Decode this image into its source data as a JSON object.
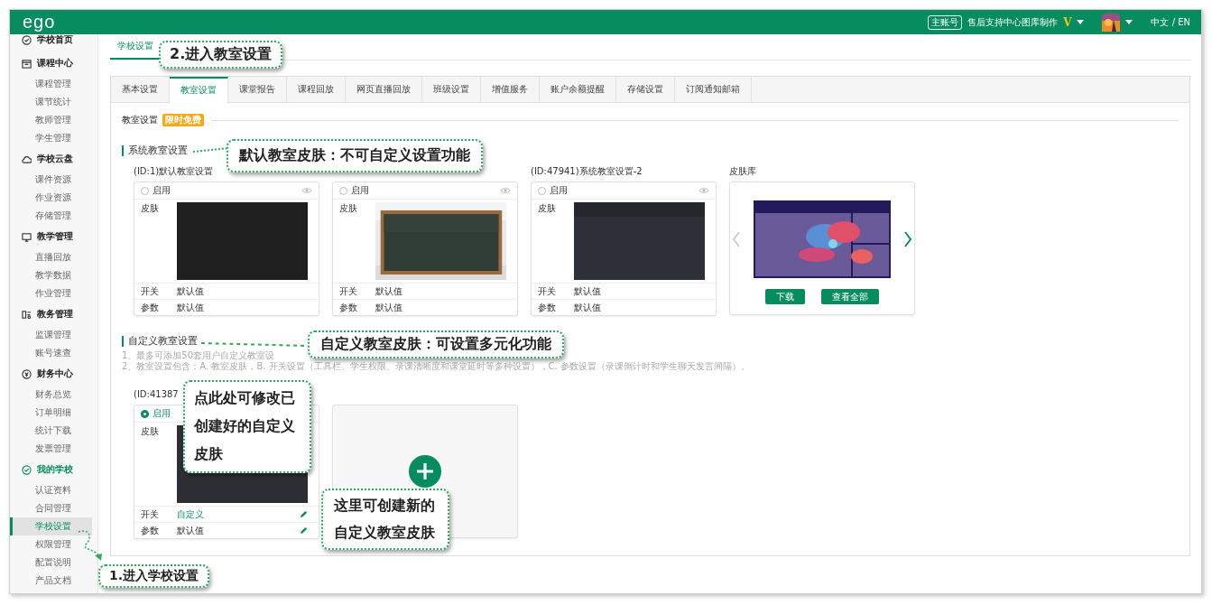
{
  "header": {
    "logo": "ego",
    "account_badge": "主账号",
    "account_name": "售后支持中心图库制作",
    "vip_mark": "V",
    "language": "中文 / EN"
  },
  "sidebar": [
    {
      "label": "学校首页",
      "selected": false
    },
    {
      "label": "课程中心",
      "selected": false,
      "children": [
        {
          "label": "课程管理",
          "selected": false
        },
        {
          "label": "课节统计",
          "selected": false
        },
        {
          "label": "教师管理",
          "selected": false
        },
        {
          "label": "学生管理",
          "selected": false
        }
      ]
    },
    {
      "label": "学校云盘",
      "selected": false,
      "children": [
        {
          "label": "课件资源",
          "selected": false
        },
        {
          "label": "作业资源",
          "selected": false
        },
        {
          "label": "存储管理",
          "selected": false
        }
      ]
    },
    {
      "label": "教学管理",
      "selected": false,
      "children": [
        {
          "label": "直播回放",
          "selected": false
        },
        {
          "label": "教学数据",
          "selected": false
        },
        {
          "label": "作业管理",
          "selected": false
        }
      ]
    },
    {
      "label": "教务管理",
      "selected": false,
      "children": [
        {
          "label": "监课管理",
          "selected": false
        },
        {
          "label": "账号速查",
          "selected": false
        }
      ]
    },
    {
      "label": "财务中心",
      "selected": false,
      "children": [
        {
          "label": "财务总览",
          "selected": false
        },
        {
          "label": "订单明细",
          "selected": false
        },
        {
          "label": "统计下载",
          "selected": false
        },
        {
          "label": "发票管理",
          "selected": false
        }
      ]
    },
    {
      "label": "我的学校",
      "selected": true,
      "children": [
        {
          "label": "认证资料",
          "selected": false
        },
        {
          "label": "合同管理",
          "selected": false
        },
        {
          "label": "学校设置",
          "selected": true
        },
        {
          "label": "权限管理",
          "selected": false
        },
        {
          "label": "配置说明",
          "selected": false
        },
        {
          "label": "产品文档",
          "selected": false
        }
      ]
    }
  ],
  "page_tabs": [
    {
      "label": "学校设置",
      "selected": true
    }
  ],
  "tabs": [
    {
      "label": "基本设置",
      "selected": false
    },
    {
      "label": "教室设置",
      "selected": true
    },
    {
      "label": "课堂报告",
      "selected": false
    },
    {
      "label": "课程回放",
      "selected": false
    },
    {
      "label": "网页直播回放",
      "selected": false
    },
    {
      "label": "班级设置",
      "selected": false
    },
    {
      "label": "增值服务",
      "selected": false
    },
    {
      "label": "账户余额提醒",
      "selected": false
    },
    {
      "label": "存储设置",
      "selected": false
    },
    {
      "label": "订阅通知邮箱",
      "selected": false
    }
  ],
  "section": {
    "title": "教室设置",
    "badge": "限时免费"
  },
  "system": {
    "title": "系统教室设置",
    "cards": [
      {
        "title": "(ID:1)默认教室设置",
        "enable_label": "启用",
        "enabled": false,
        "skin_label": "皮肤",
        "kind": "plain",
        "rows": [
          {
            "label": "开关",
            "value": "默认值",
            "custom": false,
            "editable": false
          },
          {
            "label": "参数",
            "value": "默认值",
            "custom": false,
            "editable": false
          }
        ]
      },
      {
        "enable_label": "启用",
        "enabled": false,
        "skin_label": "皮肤",
        "kind": "picture",
        "rows": [
          {
            "label": "开关",
            "value": "默认值",
            "custom": false,
            "editable": false
          },
          {
            "label": "参数",
            "value": "默认值",
            "custom": false,
            "editable": false
          }
        ]
      },
      {
        "title": "(ID:47941)系统教室设置-2",
        "enable_label": "启用",
        "enabled": false,
        "skin_label": "皮肤",
        "kind": "toolbar",
        "rows": [
          {
            "label": "开关",
            "value": "默认值",
            "custom": false,
            "editable": false
          },
          {
            "label": "参数",
            "value": "默认值",
            "custom": false,
            "editable": false
          }
        ]
      }
    ],
    "library": {
      "title": "皮肤库",
      "buttons": [
        "下载",
        "查看全部"
      ]
    }
  },
  "custom": {
    "title": "自定义教室设置",
    "notes": [
      "1、最多可添加50套用户自定义教室设",
      "2、教室设置包含：A. 教室皮肤，B. 开关设置（工具栏、学生权限、录课清晰度和课堂延时等多种设置），C. 参数设置（录课倒计时和学生聊天发言间隔）。"
    ],
    "cards": [
      {
        "title": "(ID:41387",
        "enable_label": "启用",
        "enabled": true,
        "skin_label": "皮肤",
        "kind": "plain",
        "rows": [
          {
            "label": "开关",
            "value": "自定义",
            "custom": true,
            "editable": true
          },
          {
            "label": "参数",
            "value": "默认值",
            "custom": false,
            "editable": true
          }
        ]
      }
    ]
  },
  "callouts": [
    {
      "text": "2.进入教室设置"
    },
    {
      "text": "默认教室皮肤：不可自定义设置功能"
    },
    {
      "text": "自定义教室皮肤：可设置多元化功能"
    },
    {
      "text": "点此处可修改已创建好的自定义皮肤"
    },
    {
      "text": "这里可创建新的自定义教室皮肤"
    },
    {
      "text": "1.进入学校设置"
    }
  ]
}
